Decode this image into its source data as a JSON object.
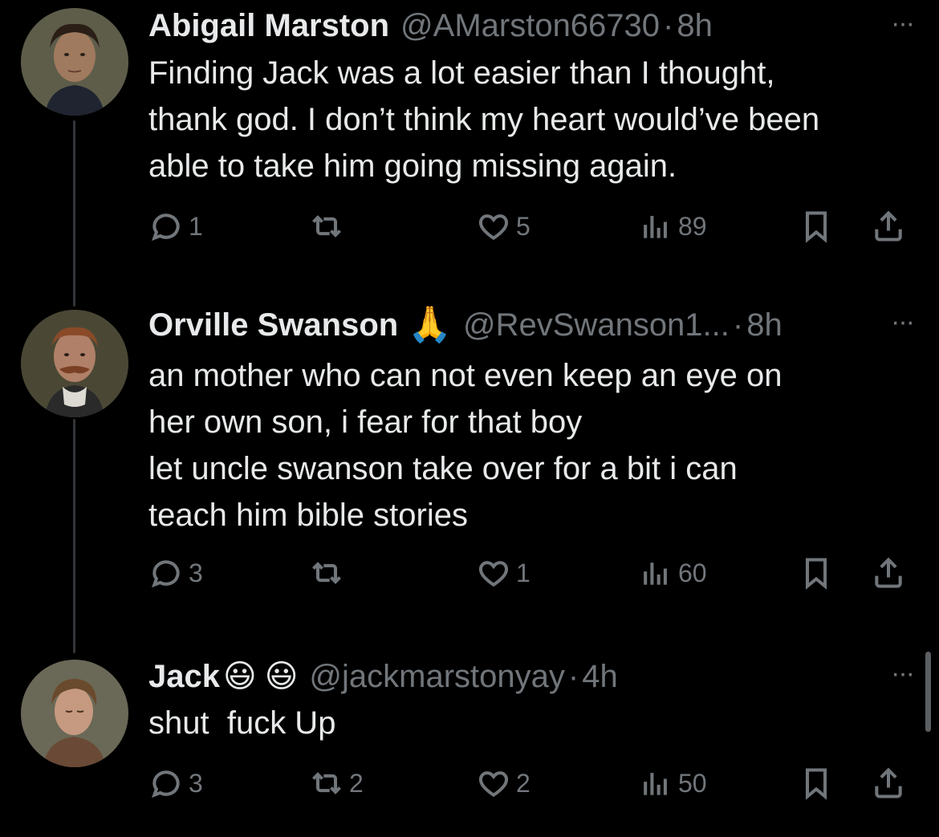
{
  "tweets": [
    {
      "name": "Abigail Marston",
      "handle": "@AMarston66730",
      "dot": "·",
      "time": "8h",
      "more": "···",
      "text": "Finding Jack was a lot easier than I thought,\nthank god. I don’t think my heart would’ve been\nable to take him going missing again.",
      "replies": "1",
      "retweets": "",
      "likes": "5",
      "views": "89"
    },
    {
      "name": "Orville Swanson",
      "emojis": [
        "🙏"
      ],
      "handle": "@RevSwanson1...",
      "dot": "·",
      "time": "8h",
      "more": "···",
      "text": "an mother who can not even keep an eye on\nher own son, i fear for that boy\nlet uncle swanson take over for a bit i can\nteach him bible stories",
      "replies": "3",
      "retweets": "",
      "likes": "1",
      "views": "60"
    },
    {
      "name": "Jack",
      "emojis": [
        "😃",
        "😃"
      ],
      "handle": "@jackmarstonyay",
      "dot": "·",
      "time": "4h",
      "more": "···",
      "text": "shut  fuck Up",
      "replies": "3",
      "retweets": "2",
      "likes": "2",
      "views": "50"
    }
  ],
  "icons": {
    "reply": "reply-icon",
    "retweet": "retweet-icon",
    "like": "heart-icon",
    "views": "views-icon",
    "bookmark": "bookmark-icon",
    "share": "share-icon"
  },
  "colors": {
    "background": "#000000",
    "text": "#e7e9ea",
    "muted": "#71767b",
    "thread_line": "#333639"
  }
}
